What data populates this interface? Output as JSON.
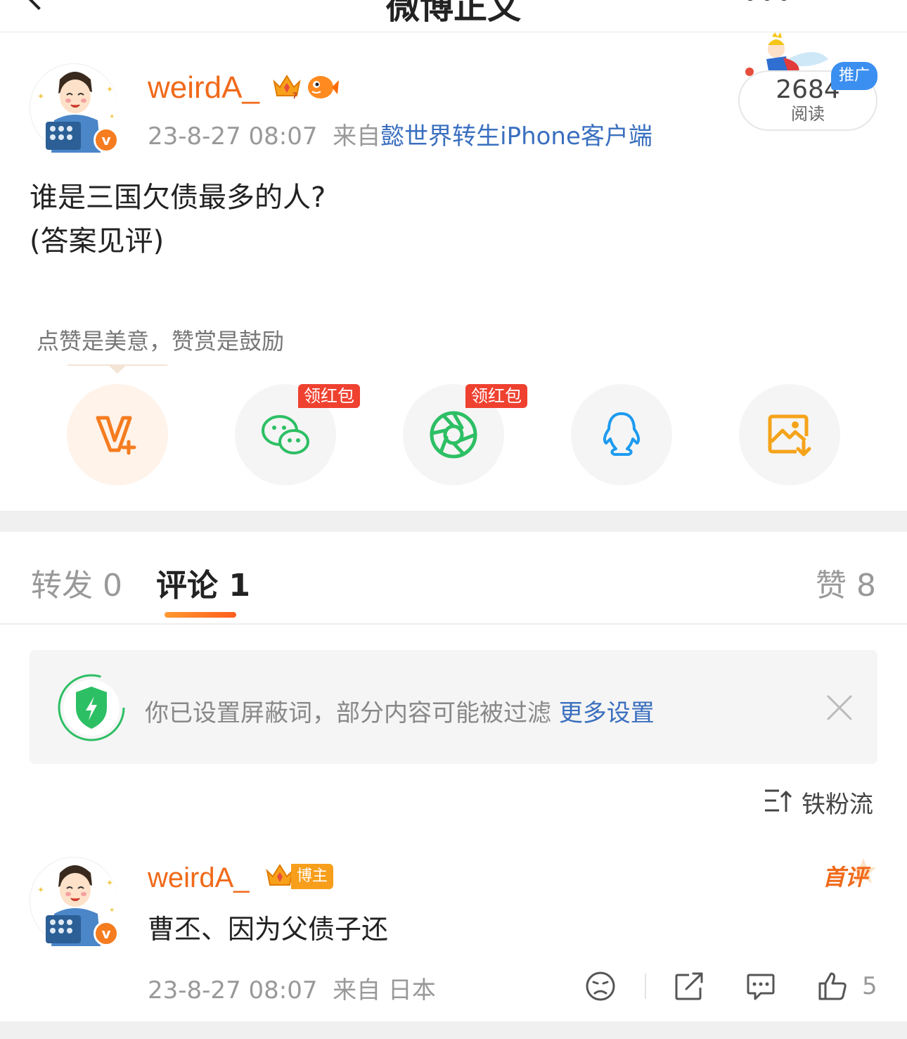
{
  "nav": {
    "title": "微博正文"
  },
  "post": {
    "author": "weirdA_",
    "time": "23-8-27 08:07",
    "source_prefix": "来自",
    "source": "懿世界转生iPhone客户端",
    "read_count": "2684",
    "read_label": "阅读",
    "promo_label": "推广",
    "body_line1": "谁是三国欠债最多的人?",
    "body_line2": "(答案见评)"
  },
  "reward": {
    "tip": "点赞是美意，赞赏是鼓励"
  },
  "share": {
    "redpack_label": "领红包",
    "items": [
      "v-plus-icon",
      "wechat-icon",
      "moments-icon",
      "qq-icon",
      "save-image-icon"
    ]
  },
  "tabs": {
    "repost": "转发 0",
    "comment": "评论 1",
    "like": "赞 8"
  },
  "filter": {
    "text": "你已设置屏蔽词，部分内容可能被过滤",
    "link": "更多设置"
  },
  "sort": {
    "label": "铁粉流"
  },
  "comment": {
    "author": "weirdA_",
    "host_tag": "博主",
    "first_badge": "首评",
    "text": "曹丕、因为父债子还",
    "time": "23-8-27 08:07",
    "location": "来自 日本",
    "like_count": "5"
  },
  "colors": {
    "accent_orange": "#f06a1a",
    "link_blue": "#3a6fbf",
    "wechat_green": "#2dbf64",
    "qq_blue": "#1d9bf0",
    "redpack_red": "#ef4130"
  }
}
